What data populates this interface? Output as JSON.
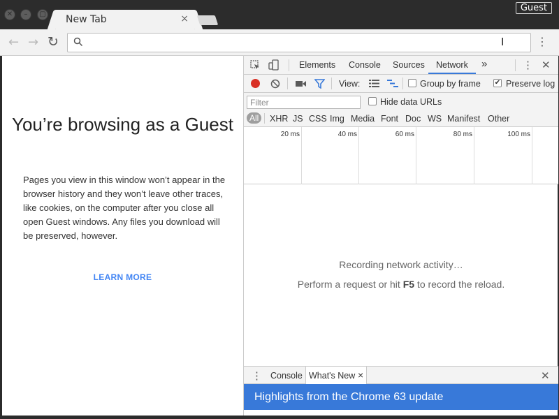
{
  "window": {
    "guest_label": "Guest"
  },
  "tabs": [
    {
      "label": "New Tab",
      "close": "×"
    }
  ],
  "toolbar": {
    "omnibox_value": ""
  },
  "page": {
    "title": "You’re browsing as a Guest",
    "description": "Pages you view in this window won’t appear in the browser history and they won’t leave other traces, like cookies, on the computer after you close all open Guest windows. Any files you download will be preserved, however.",
    "learn_more": "LEARN MORE"
  },
  "devtools": {
    "tabs": [
      "Elements",
      "Console",
      "Sources",
      "Network"
    ],
    "active_tab": "Network",
    "more": "»",
    "network": {
      "view_label": "View:",
      "group_by_frame": {
        "label": "Group by frame",
        "checked": false
      },
      "preserve_log": {
        "label": "Preserve log",
        "checked": true
      },
      "filter_placeholder": "Filter",
      "hide_data_urls": {
        "label": "Hide data URLs",
        "checked": false
      },
      "types": [
        "All",
        "XHR",
        "JS",
        "CSS",
        "Img",
        "Media",
        "Font",
        "Doc",
        "WS",
        "Manifest",
        "Other"
      ],
      "active_type": "All",
      "timeline_labels": [
        "20 ms",
        "40 ms",
        "60 ms",
        "80 ms",
        "100 ms"
      ],
      "recording_msg": "Recording network activity…",
      "reload_msg_pre": "Perform a request or hit ",
      "reload_key": "F5",
      "reload_msg_post": " to record the reload."
    },
    "drawer": {
      "tabs": [
        "Console",
        "What's New"
      ],
      "active_tab": "What's New",
      "close": "×",
      "highlights": "Highlights from the Chrome 63 update"
    }
  },
  "colors": {
    "accent_blue": "#3879d9",
    "record_red": "#d93025",
    "link_blue": "#4285f4"
  }
}
